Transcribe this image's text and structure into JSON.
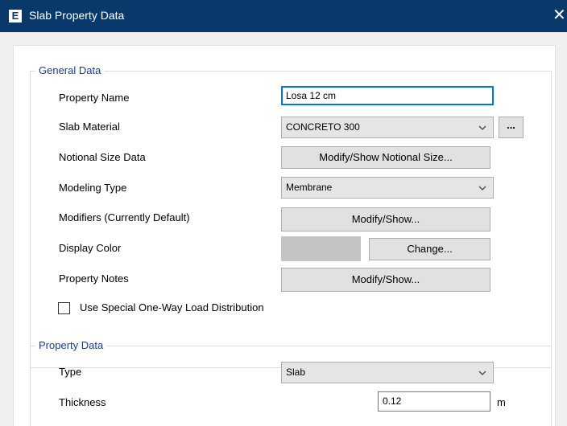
{
  "window": {
    "title": "Slab Property Data",
    "app_icon_letter": "E",
    "close_glyph": "✕"
  },
  "general": {
    "group_title": "General Data",
    "property_name": {
      "label": "Property Name",
      "value": "Losa 12 cm"
    },
    "slab_material": {
      "label": "Slab Material",
      "value": "CONCRETO 300",
      "browse_label": "..."
    },
    "notional_size": {
      "label": "Notional Size Data",
      "button": "Modify/Show Notional Size..."
    },
    "modeling_type": {
      "label": "Modeling Type",
      "value": "Membrane"
    },
    "modifiers": {
      "label": "Modifiers (Currently Default)",
      "button": "Modify/Show..."
    },
    "display_color": {
      "label": "Display Color",
      "swatch_color": "#c4c4c4",
      "button": "Change..."
    },
    "property_notes": {
      "label": "Property Notes",
      "button": "Modify/Show..."
    },
    "one_way": {
      "label": "Use Special One-Way Load Distribution",
      "checked": false
    }
  },
  "property": {
    "group_title": "Property Data",
    "type": {
      "label": "Type",
      "value": "Slab"
    },
    "thickness": {
      "label": "Thickness",
      "value": "0.12",
      "unit": "m"
    }
  }
}
